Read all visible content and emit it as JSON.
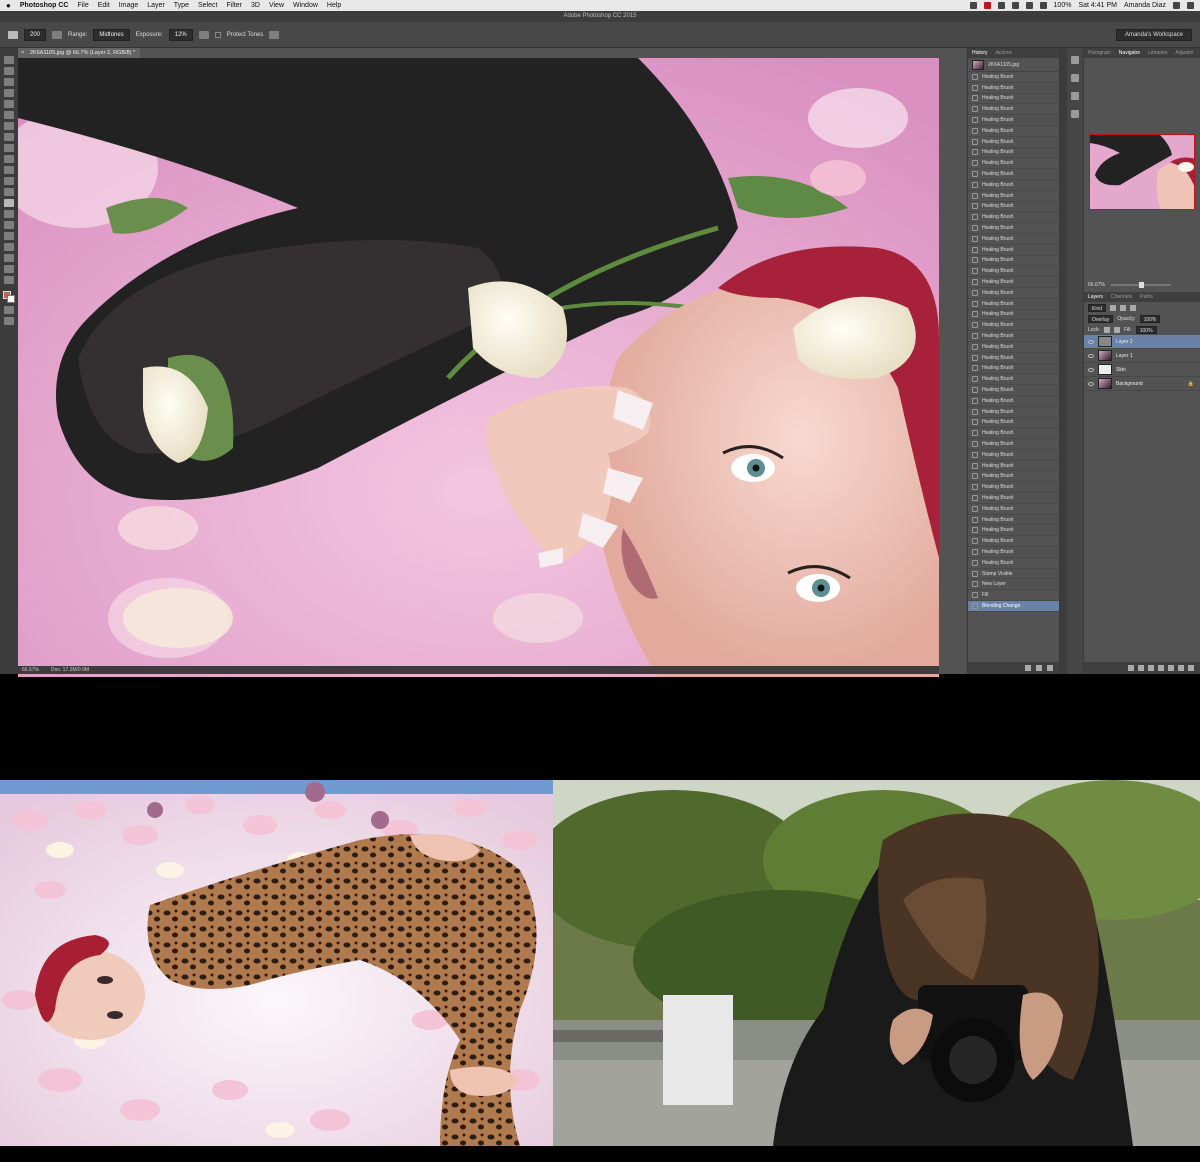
{
  "menubar": {
    "apple": "",
    "app": "Photoshop CC",
    "items": [
      "File",
      "Edit",
      "Image",
      "Layer",
      "Type",
      "Select",
      "Filter",
      "3D",
      "View",
      "Window",
      "Help"
    ],
    "battery": "100%",
    "clock": "Sat 4:41 PM",
    "user": "Amanda Diaz"
  },
  "window": {
    "title": "Adobe Photoshop CC 2015"
  },
  "options": {
    "brush_size": "200",
    "range_label": "Range:",
    "range_value": "Midtones",
    "exposure_label": "Exposure:",
    "exposure_value": "12%",
    "protect_tones": "Protect Tones",
    "workspace": "Amanda's Workspace"
  },
  "document": {
    "tab": "2K6A1105.jpg @ 66.7% (Layer 2, RGB/8) *",
    "zoom": "66.67%",
    "doc_info": "Doc: 17.2M/0.9M"
  },
  "history": {
    "tabs": [
      "History",
      "Actions"
    ],
    "snapshot": "2K6A1105.jpg",
    "steps": [
      "Healing Brush",
      "Healing Brush",
      "Healing Brush",
      "Healing Brush",
      "Healing Brush",
      "Healing Brush",
      "Healing Brush",
      "Healing Brush",
      "Healing Brush",
      "Healing Brush",
      "Healing Brush",
      "Healing Brush",
      "Healing Brush",
      "Healing Brush",
      "Healing Brush",
      "Healing Brush",
      "Healing Brush",
      "Healing Brush",
      "Healing Brush",
      "Healing Brush",
      "Healing Brush",
      "Healing Brush",
      "Healing Brush",
      "Healing Brush",
      "Healing Brush",
      "Healing Brush",
      "Healing Brush",
      "Healing Brush",
      "Healing Brush",
      "Healing Brush",
      "Healing Brush",
      "Healing Brush",
      "Healing Brush",
      "Healing Brush",
      "Healing Brush",
      "Healing Brush",
      "Healing Brush",
      "Healing Brush",
      "Healing Brush",
      "Healing Brush",
      "Healing Brush",
      "Healing Brush",
      "Healing Brush",
      "Healing Brush",
      "Healing Brush",
      "Healing Brush",
      "Stamp Visible",
      "New Layer",
      "Fill",
      "Blending Change"
    ],
    "active_index": 49
  },
  "navigator": {
    "tabs": [
      "Histogram",
      "Navigator",
      "Libraries",
      "Adjustm"
    ],
    "zoom": "66.67%"
  },
  "layers": {
    "tabs": [
      "Layers",
      "Channels",
      "Paths"
    ],
    "kind": "Kind",
    "blend_mode": "Overlay",
    "opacity_label": "Opacity:",
    "opacity": "100%",
    "lock_label": "Lock:",
    "fill_label": "Fill:",
    "fill": "100%",
    "items": [
      {
        "name": "Layer 2",
        "active": true
      },
      {
        "name": "Layer 1",
        "active": false
      },
      {
        "name": "Skin",
        "active": false
      },
      {
        "name": "Background",
        "active": false
      }
    ]
  },
  "colors": {
    "ps_bg": "#535353",
    "panel_dark": "#3c3c3c",
    "highlight": "#6a82a8",
    "nav_frame": "#c0141c",
    "canvas_pink": "#e7aed0"
  }
}
